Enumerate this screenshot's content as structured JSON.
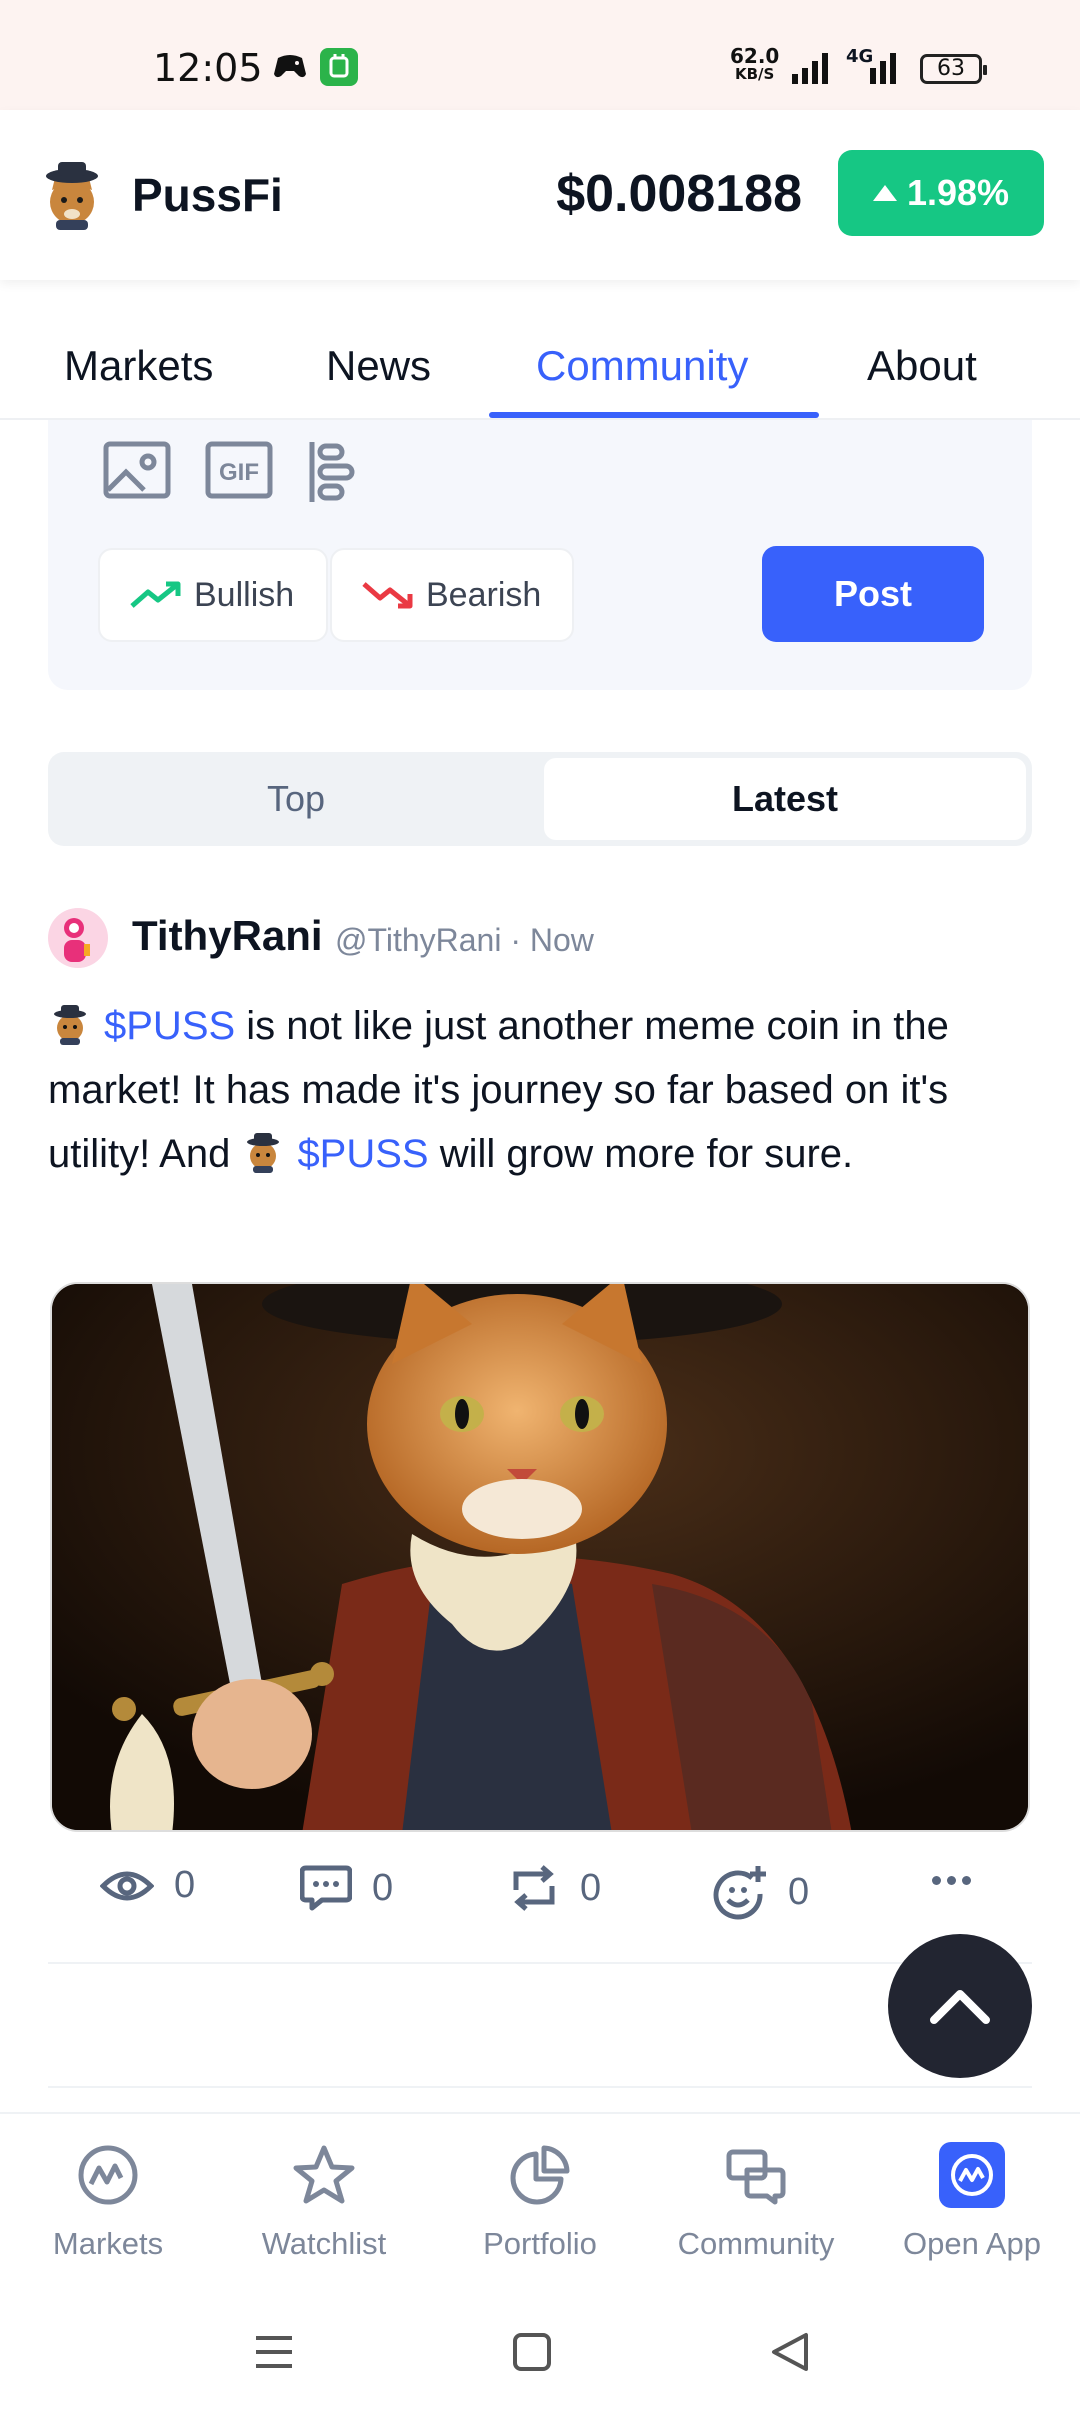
{
  "status_bar": {
    "time": "12:05",
    "speed_value": "62.0",
    "speed_unit": "KB/S",
    "network": "4G",
    "battery": "63"
  },
  "header": {
    "brand": "PussFi",
    "price": "$0.008188",
    "change": "1.98%",
    "change_color": "#16c784"
  },
  "tabs": [
    {
      "label": "Markets"
    },
    {
      "label": "News"
    },
    {
      "label": "Community",
      "active": true
    },
    {
      "label": "About"
    }
  ],
  "composer": {
    "icons": [
      "image-icon",
      "gif-icon",
      "poll-icon"
    ],
    "bullish_label": "Bullish",
    "bearish_label": "Bearish",
    "post_label": "Post"
  },
  "feed_toggle": {
    "top_label": "Top",
    "latest_label": "Latest",
    "selected": "Latest"
  },
  "post": {
    "author": "TithyRani",
    "handle_time": "@TithyRani · Now",
    "cashtag": "$PUSS",
    "text_part1": " is not like just another meme coin in the market! It has made it's journey so far based on it's utility! And ",
    "text_part2": " will grow more for sure.",
    "stats": {
      "views": "0",
      "comments": "0",
      "reposts": "0",
      "reactions": "0"
    }
  },
  "bottom_nav": [
    {
      "label": "Markets",
      "icon": "cmc-logo-icon"
    },
    {
      "label": "Watchlist",
      "icon": "star-icon"
    },
    {
      "label": "Portfolio",
      "icon": "pie-chart-icon"
    },
    {
      "label": "Community",
      "icon": "chat-icon"
    },
    {
      "label": "Open App",
      "icon": "open-app-icon"
    }
  ],
  "colors": {
    "accent": "#3861fb",
    "bullish": "#16c784",
    "bearish": "#ea3943",
    "text_primary": "#0d1421",
    "text_secondary": "#58667e"
  }
}
